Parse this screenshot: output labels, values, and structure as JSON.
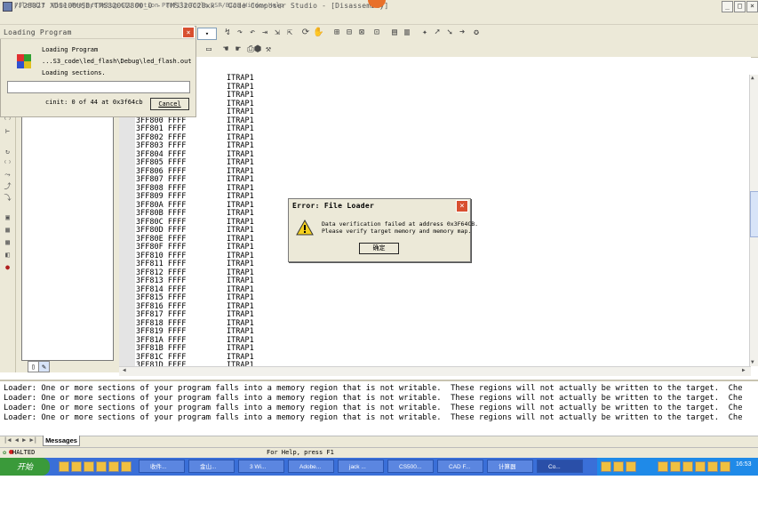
{
  "window": {
    "title": "/F28027 XDS100USB/TMS320C2800_0 - TMS320C28xx - Code Composer Studio - [Disassembly]",
    "controls": [
      "_",
      "□",
      "×"
    ]
  },
  "menu": [
    "File",
    "Edit",
    "View",
    "Project",
    "Debug",
    "GEL",
    "Option",
    "Profile",
    "Tools",
    "DSP/BIOS",
    "Window",
    "Help"
  ],
  "loading_dialog": {
    "title": "Loading Program",
    "heading": "Loading Program",
    "file": "...S3_code\\led_flash\\Debug\\led_flash.out",
    "status": "Loading sections.",
    "section_info": "cinit: 0 of 44 at 0x3f64cb",
    "cancel_label": "Cancel",
    "progress": 0
  },
  "disassembly": {
    "top_ops": [
      "ITRAP1",
      "ITRAP1",
      "ITRAP1",
      "ITRAP1",
      "ITRAP1"
    ],
    "rows": [
      {
        "addr": "3FF800",
        "data": "FFFF",
        "op": "ITRAP1"
      },
      {
        "addr": "3FF801",
        "data": "FFFF",
        "op": "ITRAP1"
      },
      {
        "addr": "3FF802",
        "data": "FFFF",
        "op": "ITRAP1"
      },
      {
        "addr": "3FF803",
        "data": "FFFF",
        "op": "ITRAP1"
      },
      {
        "addr": "3FF804",
        "data": "FFFF",
        "op": "ITRAP1"
      },
      {
        "addr": "3FF805",
        "data": "FFFF",
        "op": "ITRAP1"
      },
      {
        "addr": "3FF806",
        "data": "FFFF",
        "op": "ITRAP1"
      },
      {
        "addr": "3FF807",
        "data": "FFFF",
        "op": "ITRAP1"
      },
      {
        "addr": "3FF808",
        "data": "FFFF",
        "op": "ITRAP1"
      },
      {
        "addr": "3FF809",
        "data": "FFFF",
        "op": "ITRAP1"
      },
      {
        "addr": "3FF80A",
        "data": "FFFF",
        "op": "ITRAP1"
      },
      {
        "addr": "3FF80B",
        "data": "FFFF",
        "op": "ITRAP1"
      },
      {
        "addr": "3FF80C",
        "data": "FFFF",
        "op": "ITRAP1"
      },
      {
        "addr": "3FF80D",
        "data": "FFFF",
        "op": "ITRAP1"
      },
      {
        "addr": "3FF80E",
        "data": "FFFF",
        "op": "ITRAP1"
      },
      {
        "addr": "3FF80F",
        "data": "FFFF",
        "op": "ITRAP1"
      },
      {
        "addr": "3FF810",
        "data": "FFFF",
        "op": "ITRAP1"
      },
      {
        "addr": "3FF811",
        "data": "FFFF",
        "op": "ITRAP1"
      },
      {
        "addr": "3FF812",
        "data": "FFFF",
        "op": "ITRAP1"
      },
      {
        "addr": "3FF813",
        "data": "FFFF",
        "op": "ITRAP1"
      },
      {
        "addr": "3FF814",
        "data": "FFFF",
        "op": "ITRAP1"
      },
      {
        "addr": "3FF815",
        "data": "FFFF",
        "op": "ITRAP1"
      },
      {
        "addr": "3FF816",
        "data": "FFFF",
        "op": "ITRAP1"
      },
      {
        "addr": "3FF817",
        "data": "FFFF",
        "op": "ITRAP1"
      },
      {
        "addr": "3FF818",
        "data": "FFFF",
        "op": "ITRAP1"
      },
      {
        "addr": "3FF819",
        "data": "FFFF",
        "op": "ITRAP1"
      },
      {
        "addr": "3FF81A",
        "data": "FFFF",
        "op": "ITRAP1"
      },
      {
        "addr": "3FF81B",
        "data": "FFFF",
        "op": "ITRAP1"
      },
      {
        "addr": "3FF81C",
        "data": "FFFF",
        "op": "ITRAP1"
      },
      {
        "addr": "3FF81D",
        "data": "FFFF",
        "op": "ITRAP1"
      }
    ]
  },
  "error_dialog": {
    "title": "Error: File Loader",
    "message_line1": "Data verification failed at address 0x3F64CB.",
    "message_line2": "Please verify target memory and memory map.",
    "ok_label": "确定"
  },
  "output": {
    "lines": [
      "Loader: One or more sections of your program falls into a memory region that is not writable.  These regions will not actually be written to the target.  Che",
      "Loader: One or more sections of your program falls into a memory region that is not writable.  These regions will not actually be written to the target.  Che",
      "Loader: One or more sections of your program falls into a memory region that is not writable.  These regions will not actually be written to the target.  Che",
      "Loader: One or more sections of your program falls into a memory region that is not writable.  These regions will not actually be written to the target.  Che"
    ],
    "tab_label": "Messages"
  },
  "status": {
    "state": "HALTED",
    "help": "For Help, press F1"
  },
  "taskbar": {
    "start_label": "开始",
    "tasks": [
      "收件...",
      "金山...",
      "3 Wi...",
      "Adobe...",
      "jack ...",
      "CS500...",
      "CAD F...",
      "计算器",
      "Co..."
    ],
    "clock": "16:53"
  },
  "colors": {
    "chrome": "#ece9d8",
    "taskbar": "#3a6fd8",
    "start": "#3a9a3a",
    "close_red": "#d85030"
  }
}
